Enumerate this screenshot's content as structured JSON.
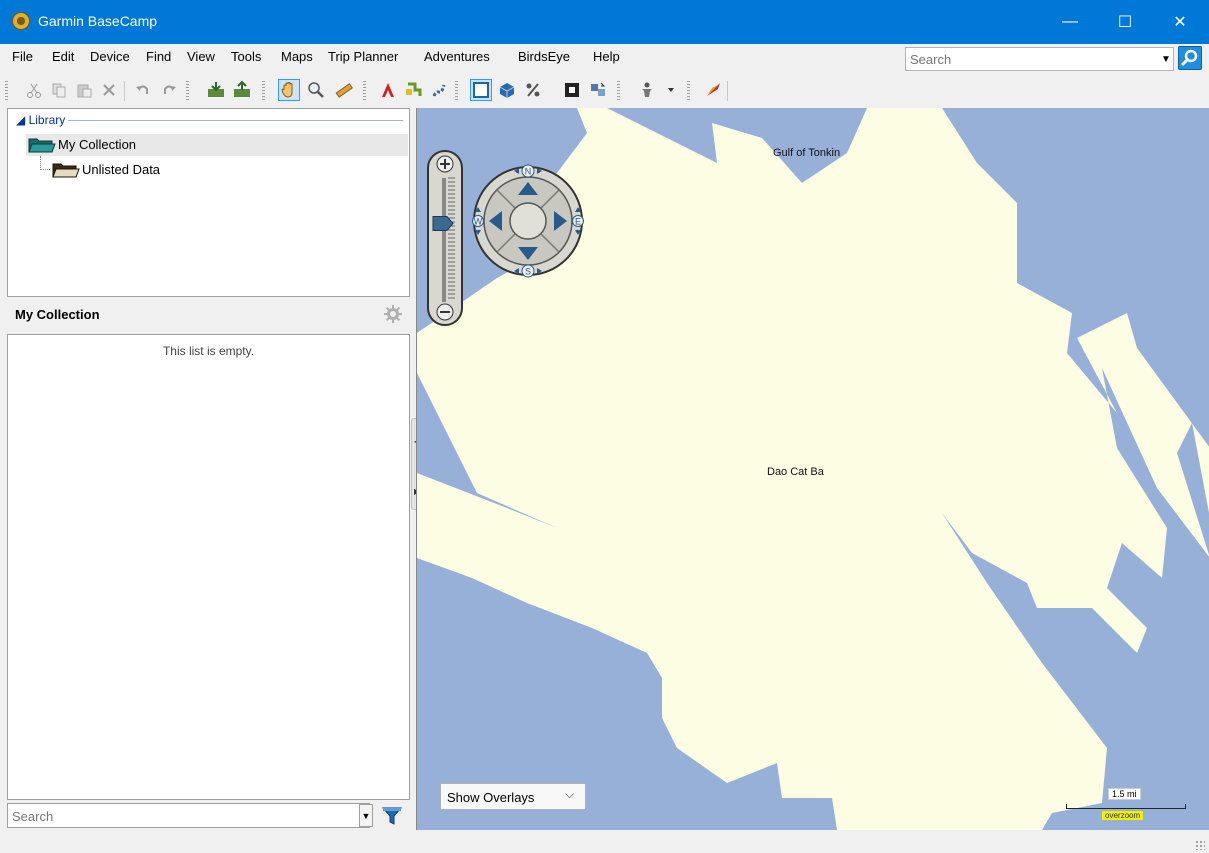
{
  "window": {
    "title": "Garmin BaseCamp",
    "minimize": "—",
    "maximize": "☐",
    "close": "✕"
  },
  "menu": [
    "File",
    "Edit",
    "Device",
    "Find",
    "View",
    "Tools",
    "Maps",
    "Trip Planner",
    "Adventures",
    "BirdsEye",
    "Help"
  ],
  "top_search": {
    "placeholder": "Search",
    "value": ""
  },
  "toolbar_icons": [
    "cut-icon",
    "copy-icon",
    "paste-icon",
    "delete-icon",
    "undo-icon",
    "redo-icon",
    "receive-from-device-icon",
    "send-to-device-icon",
    "pan-tool-icon",
    "zoom-tool-icon",
    "measure-tool-icon",
    "new-waypoint-icon",
    "new-route-icon",
    "new-track-icon",
    "2d-map-view-icon",
    "3d-map-view-icon",
    "percent-icon",
    "map-fit-icon",
    "map-sync-icon",
    "profile-icon",
    "dropdown-arrow-icon",
    "adventure-icon"
  ],
  "library": {
    "label": "Library",
    "items": [
      {
        "label": "My Collection",
        "selected": true
      },
      {
        "label": "Unlisted Data",
        "selected": false
      }
    ]
  },
  "collection": {
    "title": "My Collection",
    "empty_message": "This list is empty."
  },
  "bottom_search": {
    "placeholder": "Search",
    "value": ""
  },
  "map": {
    "labels": {
      "gulf": "Gulf of Tonkin",
      "island": "Dao Cat Ba"
    },
    "compass": {
      "n": "N",
      "s": "S",
      "e": "E",
      "w": "W"
    },
    "overlays_select": "Show Overlays",
    "scale": "1.5 mi",
    "overzoom": "overzoom",
    "colors": {
      "water": "#96b0d8",
      "land": "#fdfde3"
    },
    "zoom_level_fraction": 0.35
  }
}
